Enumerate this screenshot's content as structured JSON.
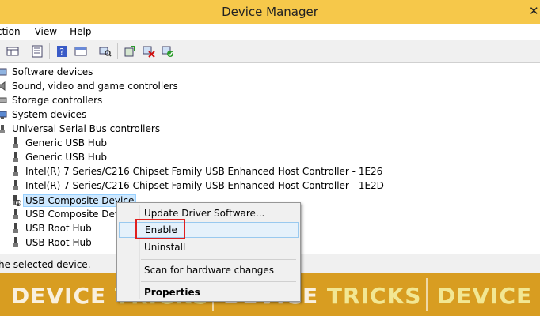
{
  "window": {
    "title": "Device Manager",
    "close_glyph": "✕"
  },
  "menu": {
    "items": [
      "ction",
      "View",
      "Help"
    ]
  },
  "toolbar": {
    "buttons": [
      "back-icon",
      "forward-icon",
      "properties-icon",
      "help-icon",
      "view-icon",
      "scan-hardware-icon",
      "update-driver-icon",
      "uninstall-icon",
      "enable-device-icon"
    ]
  },
  "tree": {
    "items": [
      {
        "label": "Software devices",
        "icon": "software-devices-icon"
      },
      {
        "label": "Sound, video and game controllers",
        "icon": "sound-icon"
      },
      {
        "label": "Storage controllers",
        "icon": "storage-icon"
      },
      {
        "label": "System devices",
        "icon": "system-devices-icon"
      },
      {
        "label": "Universal Serial Bus controllers",
        "icon": "usb-controller-icon"
      },
      {
        "label": "Generic USB Hub",
        "icon": "usb-plug-icon"
      },
      {
        "label": "Generic USB Hub",
        "icon": "usb-plug-icon"
      },
      {
        "label": "Intel(R) 7 Series/C216 Chipset Family USB Enhanced Host Controller - 1E26",
        "icon": "usb-plug-icon"
      },
      {
        "label": "Intel(R) 7 Series/C216 Chipset Family USB Enhanced Host Controller - 1E2D",
        "icon": "usb-plug-icon"
      },
      {
        "label": "USB Composite Device",
        "icon": "usb-disabled-icon",
        "selected": true
      },
      {
        "label": "USB Composite Device",
        "icon": "usb-plug-icon"
      },
      {
        "label": "USB Root Hub",
        "icon": "usb-plug-icon"
      },
      {
        "label": "USB Root Hub",
        "icon": "usb-plug-icon"
      }
    ]
  },
  "status": {
    "text": "he selected device."
  },
  "banner": {
    "word1": "DEVICE",
    "word2": "TRICKS"
  },
  "context_menu": {
    "items": [
      {
        "label": "Update Driver Software..."
      },
      {
        "label": "Enable",
        "highlighted": true
      },
      {
        "label": "Uninstall"
      },
      {
        "label": "Scan for hardware changes"
      },
      {
        "label": "Properties"
      }
    ]
  },
  "colors": {
    "titlebar": "#f6c84a",
    "banner": "#d89d21",
    "highlight": "#e02020",
    "selection": "#cde8ff"
  }
}
